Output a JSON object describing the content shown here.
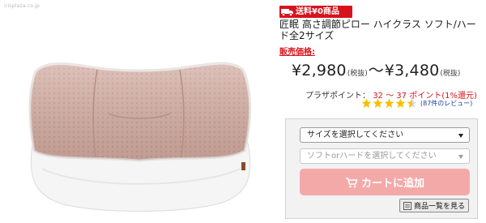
{
  "watermark": "irisplaza.co.jp",
  "badge": {
    "text": "送料¥0商品",
    "icon": "truck-icon"
  },
  "product": {
    "title": "匠眠 高さ調節ピロー ハイクラス ソフト/ハード全2サイズ",
    "price_label": "販売価格:",
    "price_min": "¥2,980",
    "price_min_tax": "(税抜)",
    "price_separator": "〜",
    "price_max": "¥3,480",
    "price_max_tax": "(税抜)"
  },
  "points": {
    "label": "プラザポイント：",
    "min": "32",
    "separator": "〜",
    "max": "37",
    "suffix": "ポイント(1%還元)"
  },
  "rating": {
    "stars": 4.5,
    "review_text": "(87件のレビュー)"
  },
  "options": {
    "size_select": "サイズを選択してください",
    "firmness_select": "ソフトorハードを選択してください",
    "cart_button": "カートに追加",
    "list_button": "商品一覧を見る"
  },
  "colors": {
    "accent_red": "#d7141d",
    "cart_pink": "#f4a9a9",
    "pillow_pink": "#d3aea4",
    "star": "#f5c000"
  }
}
